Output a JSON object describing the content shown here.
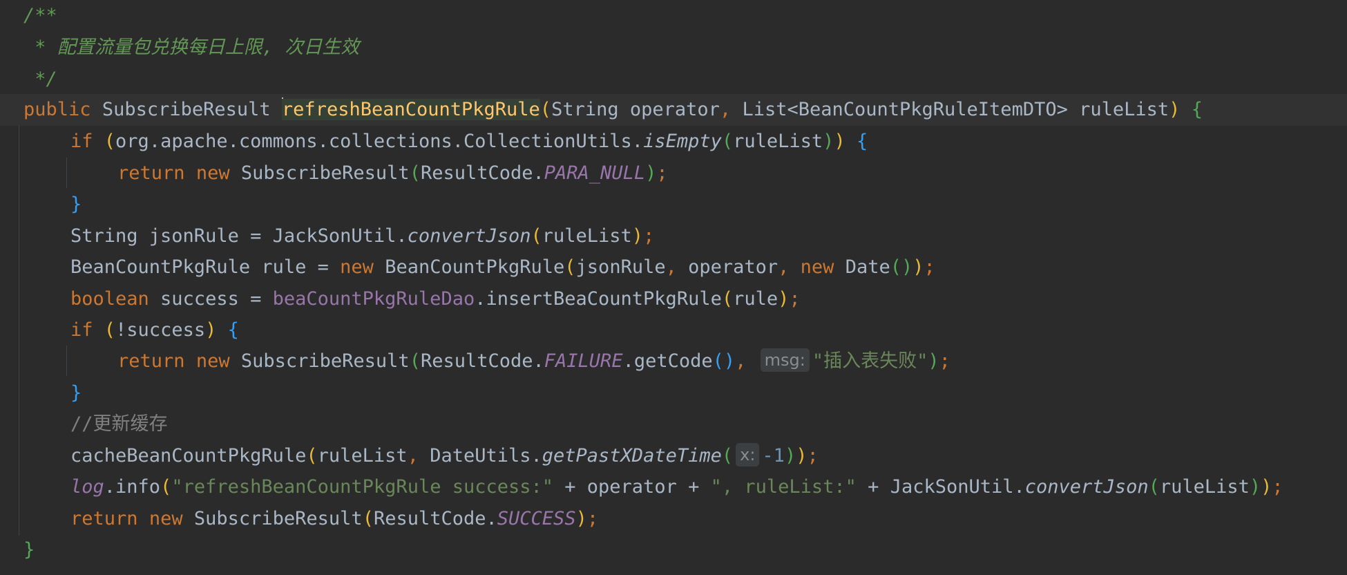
{
  "doc_comment": {
    "open": "/**",
    "body": " * 配置流量包兑换每日上限, 次日生效",
    "close": " */"
  },
  "signature": {
    "modifier": "public",
    "return_type": "SubscribeResult",
    "method_name": "refreshBeanCountPkgRule",
    "param1_type": "String",
    "param1_name": "operator",
    "param2_type": "List<BeanCountPkgRuleItemDTO>",
    "param2_name": "ruleList"
  },
  "lines": {
    "l5_prefix": "org.apache.commons.collections.CollectionUtils.",
    "l5_method": "isEmpty",
    "l5_arg": "ruleList",
    "l6_call": "SubscribeResult",
    "l6_class": "ResultCode.",
    "l6_const": "PARA_NULL",
    "l8_decl": "String jsonRule = JackSonUtil.",
    "l8_method": "convertJson",
    "l8_arg": "ruleList",
    "l9_decl": "BeanCountPkgRule rule = ",
    "l9_call": "BeanCountPkgRule",
    "l9_args": "jsonRule",
    "l9_arg2": "operator",
    "l9_date": "Date",
    "l10_type": "boolean",
    "l10_var": " success = ",
    "l10_field": "beaCountPkgRuleDao",
    "l10_method": ".insertBeaCountPkgRule",
    "l10_arg": "rule",
    "l11_cond": "!success",
    "l12_call": "SubscribeResult",
    "l12_class": "ResultCode.",
    "l12_const": "FAILURE",
    "l12_method": ".getCode",
    "l12_hint": "msg:",
    "l12_str": "\"插入表失败\"",
    "l14_comment": "//更新缓存",
    "l15_call": "cacheBeanCountPkgRule",
    "l15_arg": "ruleList",
    "l15_util": " DateUtils.",
    "l15_method": "getPastXDateTime",
    "l15_hint": "x:",
    "l15_num": "-1",
    "l16_field": "log",
    "l16_method": ".info",
    "l16_str1": "\"refreshBeanCountPkgRule success:\"",
    "l16_mid": " + operator + ",
    "l16_str2": "\", ruleList:\"",
    "l16_tail": " + JackSonUtil.",
    "l16_method2": "convertJson",
    "l16_arg": "ruleList",
    "l17_call": "SubscribeResult",
    "l17_class": "ResultCode.",
    "l17_const": "SUCCESS"
  },
  "keywords": {
    "if": "if",
    "return": "return",
    "new": "new"
  },
  "colors": {
    "background": "#2b2b2b",
    "keyword": "#cc7832",
    "method_decl": "#ffc66d",
    "string": "#6a8759",
    "constant": "#9876aa",
    "doc_comment": "#629755"
  }
}
